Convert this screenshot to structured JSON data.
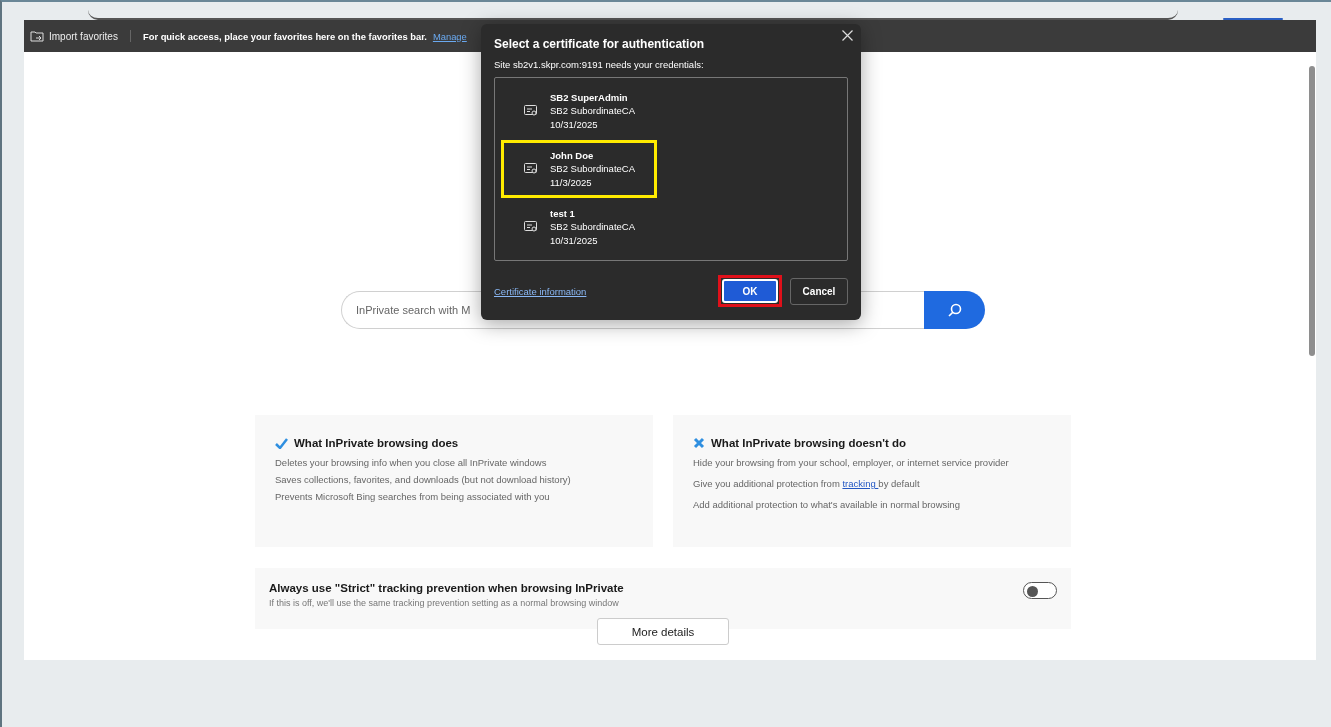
{
  "favorites_bar": {
    "import_label": "Import favorites",
    "message": "For quick access, place your favorites here on the favorites bar.",
    "link": "Manage"
  },
  "search": {
    "placeholder": "InPrivate search with M"
  },
  "cards": [
    {
      "kind": "does",
      "title": "What InPrivate browsing does",
      "items": [
        "Deletes your browsing info when you close all InPrivate windows",
        "Saves collections, favorites, and downloads (but not download history)",
        "Prevents Microsoft Bing searches from being associated with you"
      ]
    },
    {
      "kind": "doesnt",
      "title": "What InPrivate browsing doesn't do",
      "items": [
        "Hide your browsing from your school, employer, or internet service provider",
        {
          "before": "Give you additional protection from ",
          "link": "tracking ",
          "after": "by default"
        },
        "Add additional protection to what's available in normal browsing"
      ]
    }
  ],
  "strict_setting": {
    "title": "Always use \"Strict\" tracking prevention when browsing InPrivate",
    "description": "If this is off, we'll use the same tracking prevention setting as a normal browsing window",
    "on": false
  },
  "more_details": "More details",
  "dialog": {
    "title": "Select a certificate for authentication",
    "subtitle": "Site sb2v1.skpr.com:9191 needs your credentials:",
    "certificates": [
      {
        "name": "SB2 SuperAdmin",
        "issuer": "SB2 SubordinateCA",
        "date": "10/31/2025",
        "highlighted": false
      },
      {
        "name": "John Doe",
        "issuer": "SB2 SubordinateCA",
        "date": "11/3/2025",
        "highlighted": true
      },
      {
        "name": "test 1",
        "issuer": "SB2 SubordinateCA",
        "date": "10/31/2025",
        "highlighted": false
      }
    ],
    "info_link": "Certificate information",
    "ok": {
      "label": "OK",
      "highlighted": true
    },
    "cancel": "Cancel"
  }
}
